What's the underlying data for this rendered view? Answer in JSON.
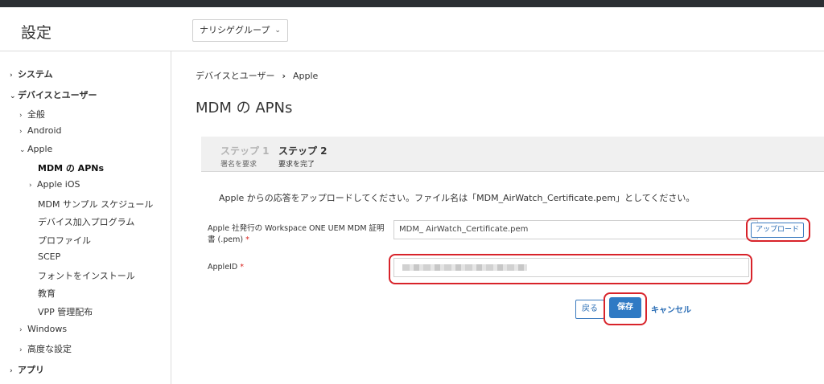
{
  "header": {
    "title": "設定",
    "org_selector": "ナリシゲグループ"
  },
  "sidebar": {
    "items": [
      {
        "label": "システム"
      },
      {
        "label": "デバイスとユーザー"
      },
      {
        "label": "全般"
      },
      {
        "label": "Android"
      },
      {
        "label": "Apple"
      },
      {
        "label": "MDM の APNs"
      },
      {
        "label": "Apple iOS"
      },
      {
        "label": "MDM サンプル スケジュール"
      },
      {
        "label": "デバイス加入プログラム"
      },
      {
        "label": "プロファイル"
      },
      {
        "label": "SCEP"
      },
      {
        "label": "フォントをインストール"
      },
      {
        "label": "教育"
      },
      {
        "label": "VPP 管理配布"
      },
      {
        "label": "Windows"
      },
      {
        "label": "高度な設定"
      },
      {
        "label": "アプリ"
      }
    ]
  },
  "breadcrumb": {
    "parent": "デバイスとユーザー",
    "current": "Apple"
  },
  "page_title": "MDM の APNs",
  "stepper": {
    "steps": [
      {
        "title": "ステップ 1",
        "desc": "署名を要求"
      },
      {
        "title": "ステップ 2",
        "desc": "要求を完了"
      }
    ]
  },
  "instruction": "Apple からの応答をアップロードしてください。ファイル名は「MDM_AirWatch_Certificate.pem」としてください。",
  "form": {
    "cert_label_line1": "Apple 社発行の Workspace ONE UEM MDM 証明",
    "cert_label_line2": "書 (.pem)",
    "required_mark": "*",
    "cert_value": "MDM_ AirWatch_Certificate.pem",
    "upload_button": "アップロード",
    "apple_id_label": "AppleID"
  },
  "actions": {
    "back": "戻る",
    "save": "保存",
    "cancel": "キャンセル"
  },
  "colors": {
    "highlight": "#d8232a",
    "primary": "#2f7ac4"
  }
}
